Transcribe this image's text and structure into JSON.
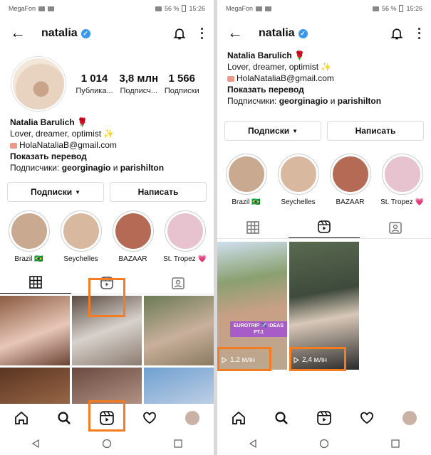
{
  "status_bar": {
    "carrier": "MegaFon",
    "battery": "56 %",
    "time": "15:26"
  },
  "profile": {
    "username": "natalia",
    "stats": [
      {
        "value": "1 014",
        "label": "Публика..."
      },
      {
        "value": "3,8 млн",
        "label": "Подписч..."
      },
      {
        "value": "1 566",
        "label": "Подписки"
      }
    ],
    "full_name": "Natalia Barulich",
    "bio_line": "Lover, dreamer, optimist",
    "email": "HolaNataliaB@gmail.com",
    "translate": "Показать перевод",
    "followers_prefix": "Подписчики: ",
    "follower_1": "georginagio",
    "followers_and": " и ",
    "follower_2": "parishilton"
  },
  "actions": {
    "following_label": "Подписки",
    "message_label": "Написать"
  },
  "highlights": [
    {
      "label": "Brazil 🇧🇷",
      "color": "#c9a990"
    },
    {
      "label": "Seychelles",
      "color": "#d8b9a0"
    },
    {
      "label": "BAZAAR",
      "color": "#b46a55"
    },
    {
      "label": "St. Tropez 💗",
      "color": "#e6c3cf"
    }
  ],
  "reels": [
    {
      "views": "1,2 млн",
      "caption": "EUROTRIP ✈️ IDEAS PT.1"
    },
    {
      "views": "2,4 млн"
    }
  ],
  "colors": {
    "highlight_box": "#f47b20",
    "verified": "#3897f0"
  }
}
